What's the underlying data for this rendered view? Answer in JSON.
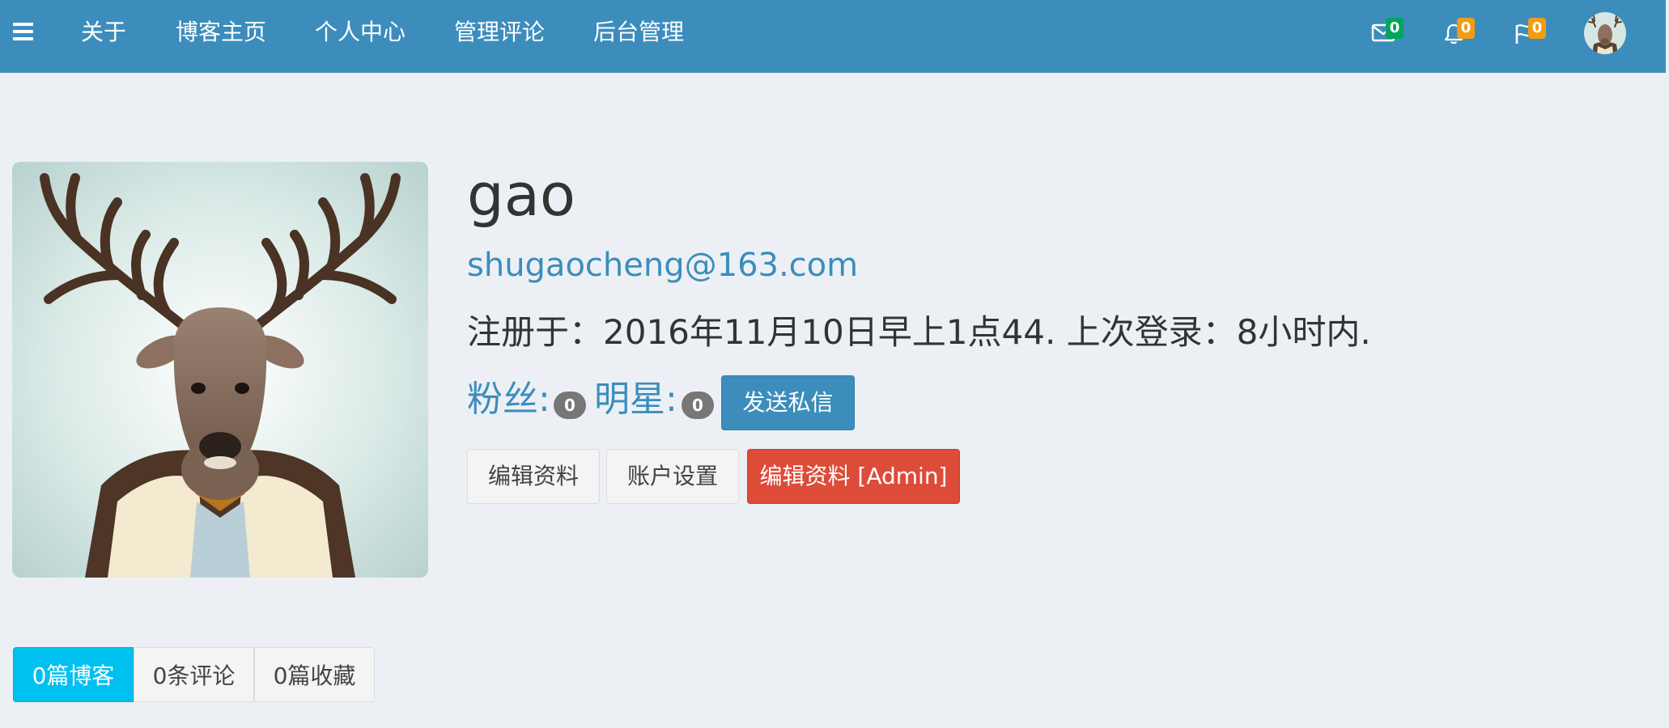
{
  "nav": {
    "items": [
      {
        "label": "关于"
      },
      {
        "label": "博客主页"
      },
      {
        "label": "个人中心"
      },
      {
        "label": "管理评论"
      },
      {
        "label": "后台管理"
      }
    ],
    "messages": {
      "icon": "envelope-icon",
      "count": "0",
      "badge_color": "#00a65a"
    },
    "notifications": {
      "icon": "bell-icon",
      "count": "0",
      "badge_color": "#f39c12"
    },
    "tasks": {
      "icon": "flag-icon",
      "count": "0",
      "badge_color": "#f39c12"
    }
  },
  "profile": {
    "username": "gao",
    "email": "shugaocheng@163.com",
    "registration": "注册于：2016年11月10日早上1点44. 上次登录：8小时内.",
    "followers_label": "粉丝:",
    "followers_count": "0",
    "following_label": "明星:",
    "following_count": "0",
    "send_message_label": "发送私信",
    "edit_profile_label": "编辑资料",
    "account_settings_label": "账户设置",
    "edit_profile_admin_label": "编辑资料 [Admin]"
  },
  "tabs": [
    {
      "label": "0篇博客",
      "active": true
    },
    {
      "label": "0条评论",
      "active": false
    },
    {
      "label": "0篇收藏",
      "active": false
    }
  ],
  "colors": {
    "header": "#3c8dbc",
    "page_background": "#ecf0f5",
    "link": "#3c8dbc",
    "primary": "#3c8dbc",
    "danger": "#dd4b39",
    "active_tab": "#00c0ef",
    "count_badge": "#777777"
  }
}
